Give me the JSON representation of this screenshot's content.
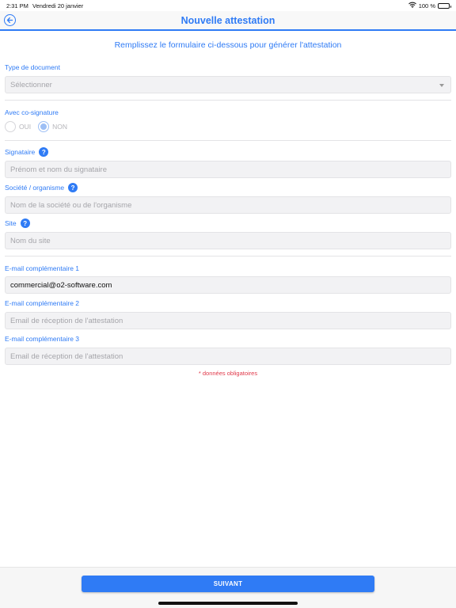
{
  "status_bar": {
    "time": "2:31 PM",
    "date": "Vendredi 20 janvier",
    "battery": "100 %",
    "battery_level": 1.0
  },
  "nav": {
    "title": "Nouvelle attestation"
  },
  "subtitle": "Remplissez le formulaire ci-dessous pour générer l'attestation",
  "form": {
    "document_type": {
      "label": "Type de document",
      "selected": "Sélectionner"
    },
    "cosign": {
      "label": "Avec co-signature",
      "options": [
        "OUI",
        "NON"
      ],
      "selected": "NON"
    },
    "signatory": {
      "label": "Signataire",
      "placeholder": "Prénom et nom du signataire",
      "help": "?"
    },
    "company": {
      "label": "Société / organisme",
      "placeholder": "Nom de la société ou de l'organisme",
      "help": "?"
    },
    "site": {
      "label": "Site",
      "placeholder": "Nom du site",
      "help": "?"
    },
    "email1": {
      "label": "E-mail complémentaire 1",
      "value": "commercial@o2-software.com"
    },
    "email2": {
      "label": "E-mail complémentaire 2",
      "placeholder": "Email de réception de l'attestation"
    },
    "email3": {
      "label": "E-mail complémentaire 3",
      "placeholder": "Email de réception de l'attestation"
    },
    "required_note": "* données obligatoires"
  },
  "footer": {
    "next_label": "SUIVANT"
  },
  "colors": {
    "accent": "#2f7bf5",
    "required": "#e0394a"
  }
}
